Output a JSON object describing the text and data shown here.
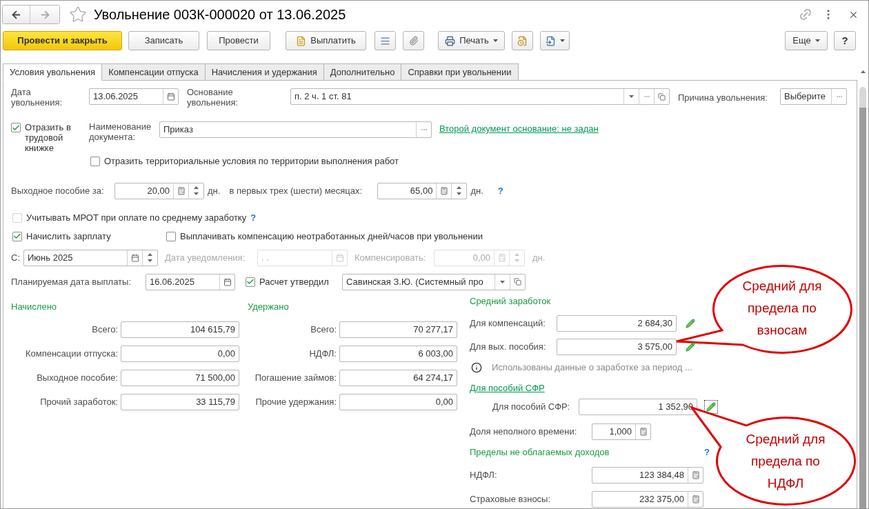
{
  "window": {
    "title": "Увольнение 003К-000020 от 13.06.2025"
  },
  "toolbar": {
    "primary": "Провести и закрыть",
    "write": "Записать",
    "post": "Провести",
    "pay": "Выплатить",
    "print": "Печать",
    "more": "Еще",
    "help": "?"
  },
  "tabs": [
    {
      "label": "Условия увольнения",
      "selected": true
    },
    {
      "label": "Компенсации отпуска",
      "selected": false
    },
    {
      "label": "Начисления и удержания",
      "selected": false
    },
    {
      "label": "Дополнительно",
      "selected": false
    },
    {
      "label": "Справки при увольнении",
      "selected": false
    }
  ],
  "dismissal": {
    "date_label": "Дата увольнения:",
    "date": "13.06.2025",
    "basis_label": "Основание увольнения:",
    "basis": "п. 2 ч. 1 ст. 81",
    "reason_label": "Причина увольнения:",
    "reason": "Выберите"
  },
  "work_book": {
    "label": "Отразить в трудовой книжке",
    "checked": true,
    "doc_name_label": "Наименование документа:",
    "doc_name": "Приказ",
    "second_doc_link": "Второй документ основание: не задан"
  },
  "territorial": {
    "label": "Отразить территориальные условия по территории выполнения работ",
    "checked": false
  },
  "severance": {
    "label": "Выходное пособие за:",
    "days": "20,00",
    "unit": "дн.",
    "months_label": "в первых трех (шести) месяцах:",
    "months_days": "65,00",
    "months_unit": "дн.",
    "help": "?"
  },
  "mrot": {
    "label": "Учитывать МРОТ при оплате по среднему заработку",
    "checked": false,
    "help": "?"
  },
  "accrue_salary": {
    "label": "Начислить зарплату",
    "checked": true
  },
  "pay_compensation": {
    "label": "Выплачивать компенсацию неотработанных дней/часов при увольнении",
    "checked": false
  },
  "period": {
    "label": "С:",
    "value": "Июнь 2025"
  },
  "notice": {
    "label": "Дата уведомления:",
    "value": ".  .",
    "disabled": true
  },
  "compensate": {
    "label": "Компенсировать:",
    "value": "0,00",
    "unit": "дн.",
    "disabled": true
  },
  "payment": {
    "label": "Планируемая дата выплаты:",
    "date": "16.06.2025"
  },
  "approved": {
    "label": "Расчет утвердил",
    "checked": true,
    "approver": "Савинская З.Ю. (Системный про"
  },
  "accrued": {
    "title": "Начислено",
    "rows": [
      {
        "label": "Всего:",
        "value": "104 615,79"
      },
      {
        "label": "Компенсации отпуска:",
        "value": "0,00"
      },
      {
        "label": "Выходное пособие:",
        "value": "71 500,00"
      },
      {
        "label": "Прочий заработок:",
        "value": "33 115,79"
      }
    ]
  },
  "withheld": {
    "title": "Удержано",
    "rows": [
      {
        "label": "Всего:",
        "value": "70 277,17"
      },
      {
        "label": "НДФЛ:",
        "value": "6 003,00"
      },
      {
        "label": "Погашение займов:",
        "value": "64 274,17"
      },
      {
        "label": "Прочие удержания:",
        "value": "0,00"
      }
    ]
  },
  "average": {
    "title": "Средний заработок",
    "rows": [
      {
        "label": "Для компенсаций:",
        "value": "2 684,30"
      },
      {
        "label": "Для вых. пособия:",
        "value": "3 575,00"
      }
    ],
    "info": "Использованы данные о заработке за период ...",
    "sfr_link": "Для пособий СФР",
    "sfr": {
      "label": "Для пособий СФР:",
      "value": "1 352,90",
      "pencil_focused": true
    },
    "part_time": {
      "label": "Доля неполного времени:",
      "value": "1,000"
    }
  },
  "limits": {
    "title": "Пределы не облагаемых доходов",
    "help": "?",
    "rows": [
      {
        "label": "НДФЛ:",
        "value": "123 384,48"
      },
      {
        "label": "Страховые взносы:",
        "value": "232 375,00"
      }
    ]
  },
  "callouts": [
    {
      "text": "Средний для предела по взносам"
    },
    {
      "text": "Средний для предела по НДФЛ"
    }
  ]
}
